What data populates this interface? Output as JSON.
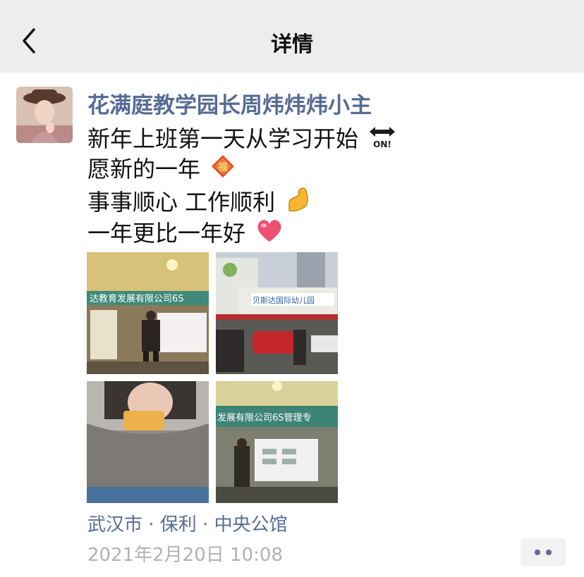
{
  "navbar": {
    "title": "详情"
  },
  "post": {
    "author": "花满庭教学园长周炜炜炜小主",
    "lines": [
      {
        "text": "新年上班第一天从学习开始",
        "emoji": "on-arrow-icon"
      },
      {
        "text": "愿新的一年",
        "emoji": "fu-diamond-icon"
      },
      {
        "text": "事事顺心 工作顺利 ",
        "emoji": "flexed-biceps-icon"
      },
      {
        "text": "一年更比一年好",
        "emoji": "heart-icon"
      }
    ],
    "emoji_on_label": "ON!",
    "emoji_fu_label": "福",
    "location": "武汉市 · 保利 · 中央公馆",
    "timestamp": "2021年2月20日 10:08",
    "photos": [
      {
        "name": "photo-classroom-speaker",
        "banner": "达教育发展有限公司6S"
      },
      {
        "name": "photo-kindergarten-gate",
        "sign": "贝斯达国际幼儿园"
      },
      {
        "name": "photo-car-selfie-mirror"
      },
      {
        "name": "photo-classroom-presentation",
        "banner": "发展有限公司6S管理专"
      }
    ]
  },
  "colors": {
    "link": "#576b95",
    "navbar_bg": "#ededed",
    "timestamp": "#b2b2b2"
  }
}
